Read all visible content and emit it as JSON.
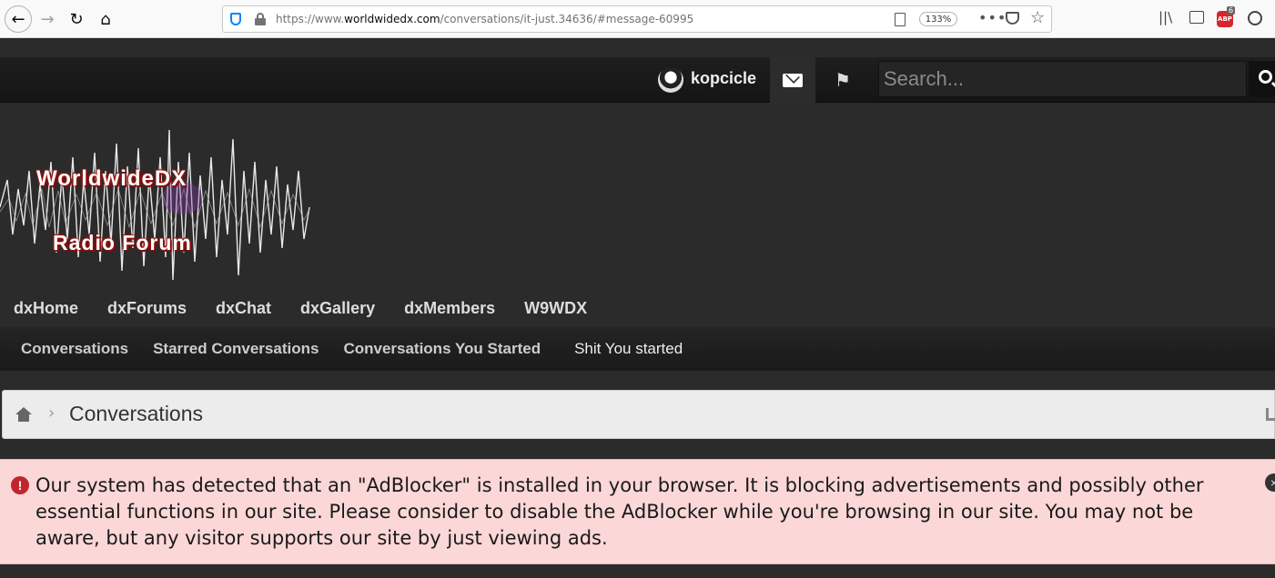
{
  "browser": {
    "url_prefix": "https://www.",
    "url_domain": "worldwidedx.com",
    "url_path": "/conversations/it-just.34636/#message-60995",
    "zoom": "133%",
    "abp_label": "ABP",
    "abp_count": "6"
  },
  "header": {
    "username": "kopcicle",
    "search_placeholder": "Search..."
  },
  "logo": {
    "line1": "WorldwideDX",
    "line2": "Radio Forum"
  },
  "main_nav": [
    {
      "label": "dxHome"
    },
    {
      "label": "dxForums"
    },
    {
      "label": "dxChat"
    },
    {
      "label": "dxGallery"
    },
    {
      "label": "dxMembers"
    },
    {
      "label": "W9WDX"
    }
  ],
  "sub_nav": [
    {
      "label": "Conversations"
    },
    {
      "label": "Starred Conversations"
    },
    {
      "label": "Conversations You Started"
    },
    {
      "label": "Shit You started"
    }
  ],
  "breadcrumb": {
    "title": "Conversations"
  },
  "notice": {
    "text": "Our system has detected that an \"AdBlocker\" is installed in your browser. It is blocking advertisements and possibly other essential functions in our site. Please consider to disable the AdBlocker while you're browsing in our site. You may not be aware, but any visitor supports our site by just viewing ads."
  },
  "colors": {
    "notice_bg": "#fbd7d7",
    "error_red": "#c0262c",
    "header_bg": "#1e1e1e"
  }
}
